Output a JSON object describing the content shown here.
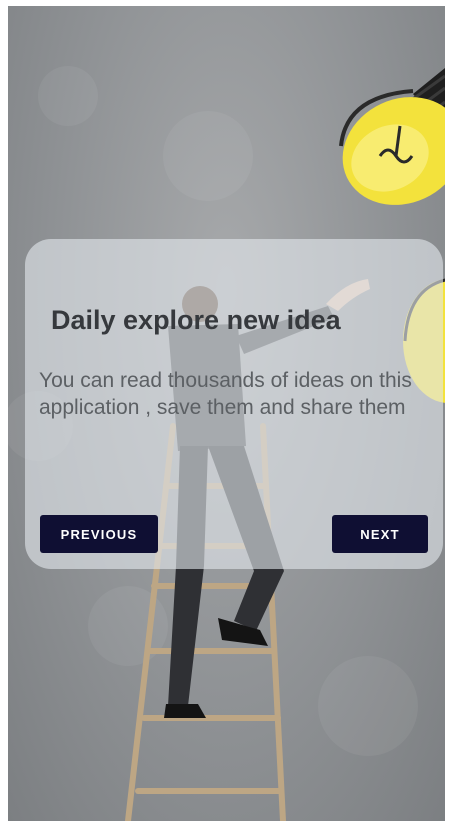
{
  "onboarding": {
    "title": "Daily explore new idea",
    "description": "You can read thousands of ideas on this application , save them and share them",
    "previous_label": "PREVIOUS",
    "next_label": "NEXT"
  },
  "background": {
    "subject": "man-climbing-ladder-illustration",
    "icons": [
      "lightbulb-icon",
      "lightbulb-icon"
    ]
  },
  "colors": {
    "button_bg": "#0f0f33",
    "button_text": "#ffffff",
    "card_bg": "#e2e6ec",
    "title_text": "#36393d",
    "body_text": "#5c6064",
    "bulb_yellow": "#f3e23c"
  }
}
